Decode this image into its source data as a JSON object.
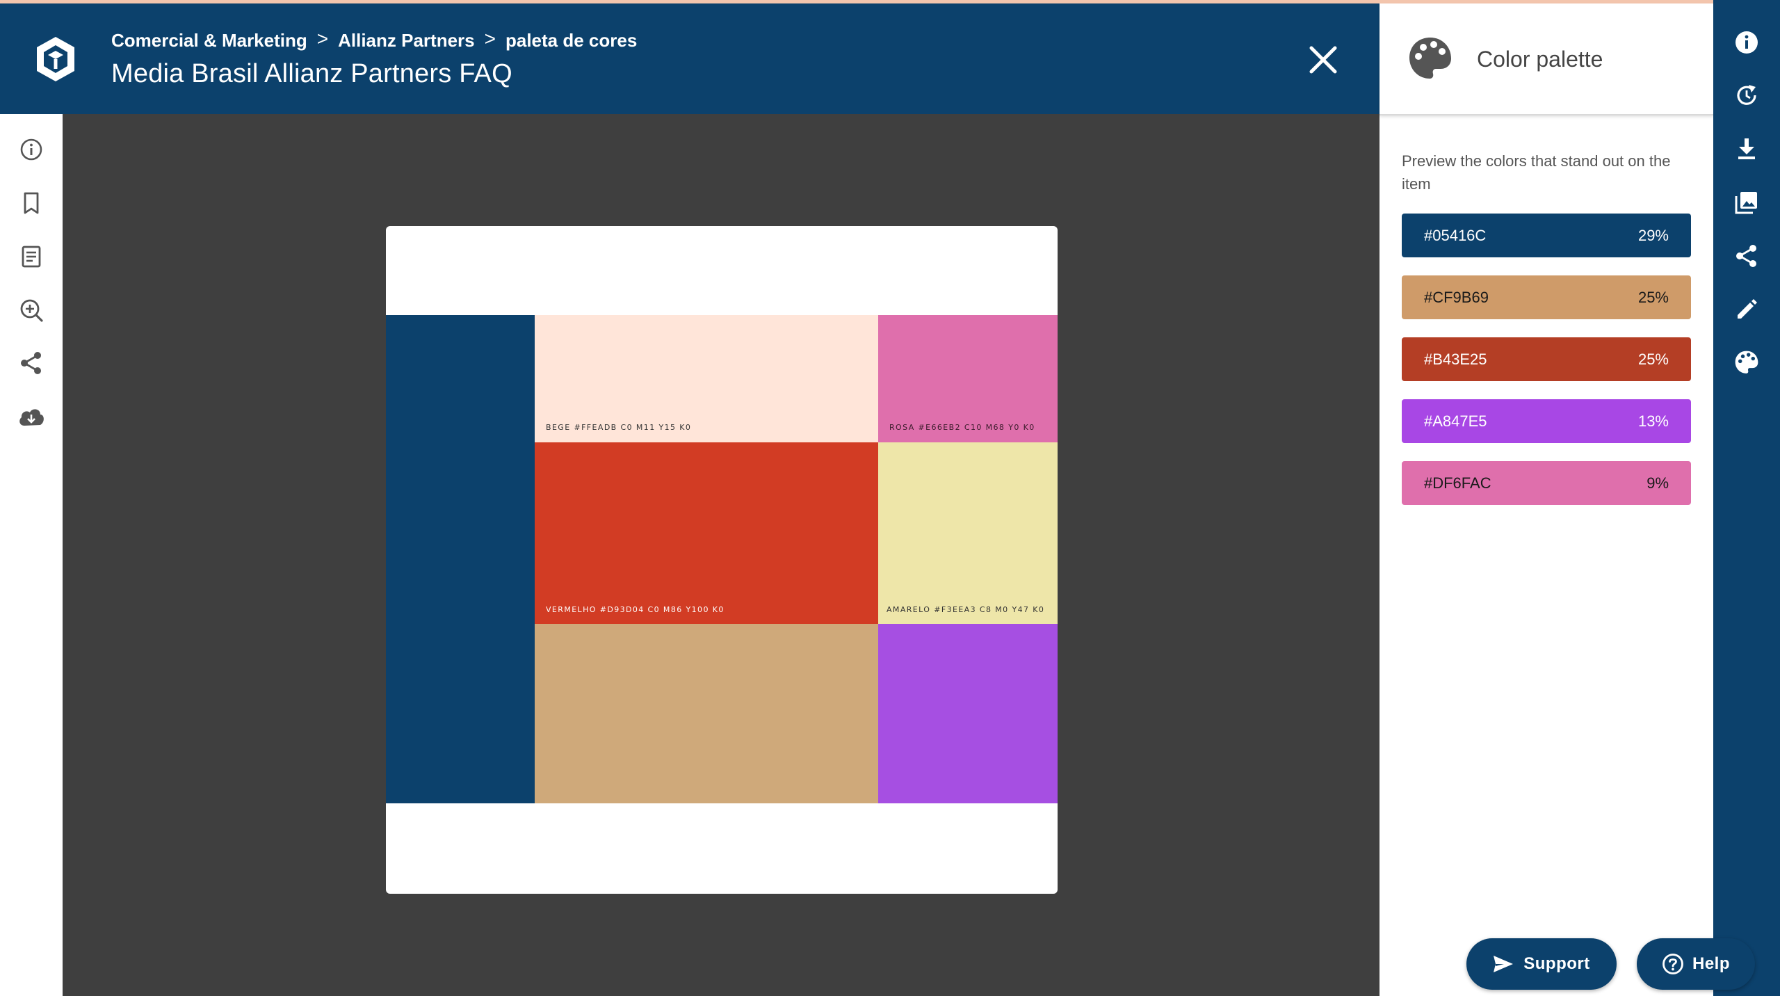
{
  "header": {
    "breadcrumbs": [
      "Comercial & Marketing",
      "Allianz Partners",
      "paleta de cores"
    ],
    "separator": ">",
    "title": "Media Brasil Allianz Partners FAQ"
  },
  "left_rail": {
    "icons": [
      "info-icon",
      "bookmark-icon",
      "document-icon",
      "zoom-in-icon",
      "share-icon",
      "cloud-download-icon"
    ]
  },
  "preview": {
    "swatches": [
      {
        "name": "navy",
        "color": "#0c416c",
        "label": ""
      },
      {
        "name": "bege",
        "color": "#ffe5d9",
        "label": "BEGE #FFEADB  C0 M11 Y15 K0",
        "label_color": "#333333"
      },
      {
        "name": "rosa",
        "color": "#df6fac",
        "label": "ROSA #E66EB2  C10 M68 Y0 K0",
        "label_color": "#3a1a2a"
      },
      {
        "name": "vermelho",
        "color": "#d23c24",
        "label": "VERMELHO #D93D04  C0 M86 Y100 K0",
        "label_color": "#ffffff"
      },
      {
        "name": "amarelo",
        "color": "#eee6a9",
        "label": "AMARELO #F3EEA3  C8 M0 Y47 K0",
        "label_color": "#333333"
      },
      {
        "name": "tan",
        "color": "#cfa97a",
        "label": ""
      },
      {
        "name": "roxo",
        "color": "#a64fe2",
        "label": ""
      }
    ]
  },
  "panel": {
    "title": "Color palette",
    "description": "Preview the colors that stand out on the item",
    "colors": [
      {
        "hex": "#05416C",
        "percent": "29%",
        "bg": "#0c416c",
        "fg": "#ffffff"
      },
      {
        "hex": "#CF9B69",
        "percent": "25%",
        "bg": "#cf9b69",
        "fg": "#1a1a1a"
      },
      {
        "hex": "#B43E25",
        "percent": "25%",
        "bg": "#b43e25",
        "fg": "#ffffff"
      },
      {
        "hex": "#A847E5",
        "percent": "13%",
        "bg": "#a847e5",
        "fg": "#ffffff"
      },
      {
        "hex": "#DF6FAC",
        "percent": "9%",
        "bg": "#df6fac",
        "fg": "#1a1a1a"
      }
    ]
  },
  "right_rail": {
    "icons": [
      "info-icon",
      "history-icon",
      "download-icon",
      "gallery-icon",
      "share-icon",
      "edit-icon",
      "palette-icon"
    ]
  },
  "buttons": {
    "support": "Support",
    "help": "Help"
  },
  "colors": {
    "primary": "#0c416c",
    "canvas": "#3f3f3f"
  }
}
